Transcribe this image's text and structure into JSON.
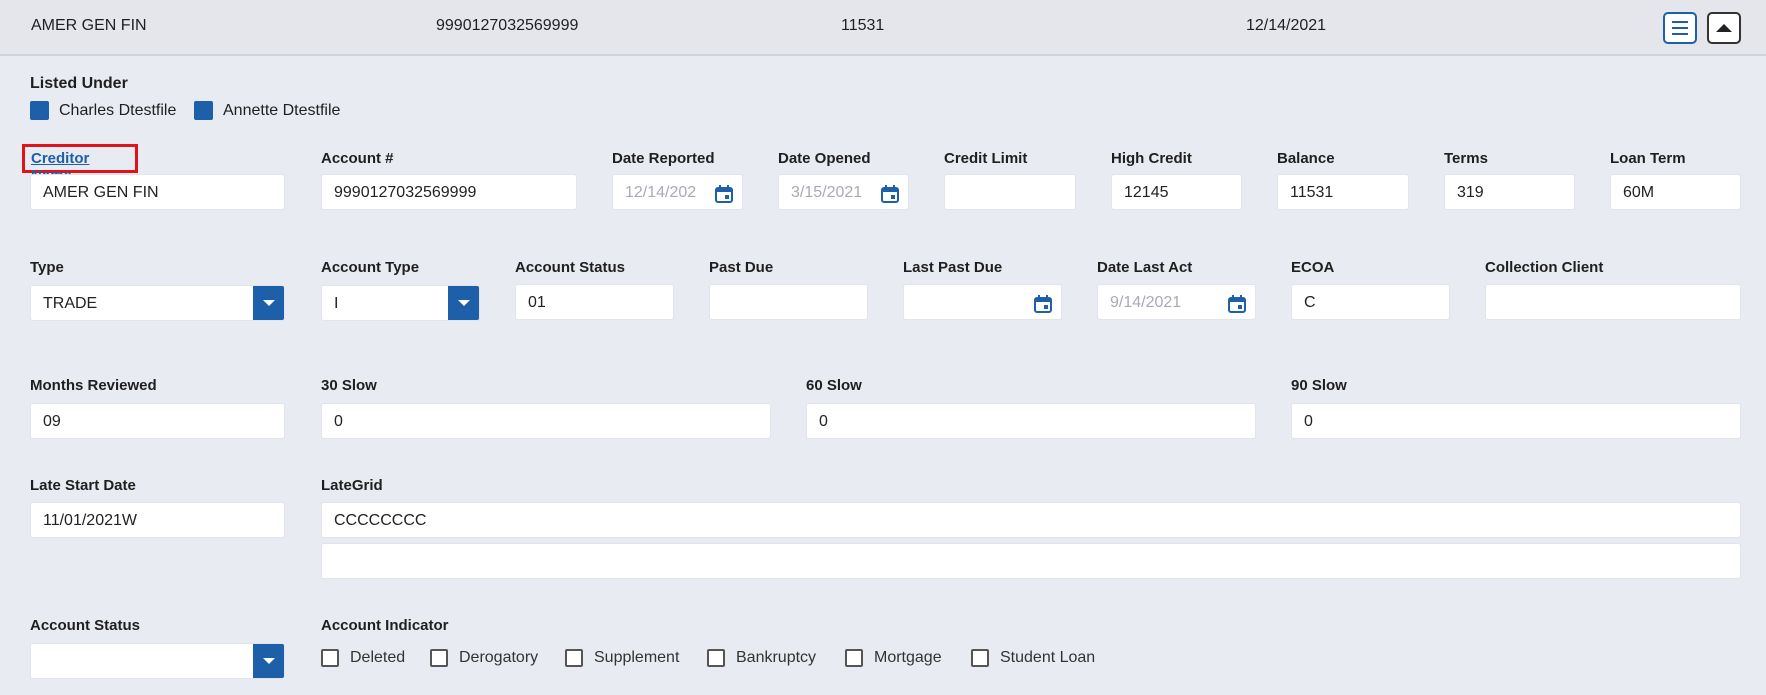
{
  "header": {
    "creditor": "AMER GEN FIN",
    "account": "9990127032569999",
    "balance": "11531",
    "date": "12/14/2021"
  },
  "listed_under": {
    "label": "Listed Under",
    "names": [
      "Charles Dtestfile",
      "Annette Dtestfile"
    ]
  },
  "row1": {
    "creditor_name_label": "Creditor Name",
    "creditor_name": "AMER GEN FIN",
    "account_label": "Account #",
    "account": "9990127032569999",
    "date_reported_label": "Date Reported",
    "date_reported": "12/14/202",
    "date_opened_label": "Date Opened",
    "date_opened": "3/15/2021",
    "credit_limit_label": "Credit Limit",
    "credit_limit": "",
    "high_credit_label": "High Credit",
    "high_credit": "12145",
    "balance_label": "Balance",
    "balance": "11531",
    "terms_label": "Terms",
    "terms": "319",
    "loan_term_label": "Loan Term",
    "loan_term": "60M"
  },
  "row2": {
    "type_label": "Type",
    "type": "TRADE",
    "account_type_label": "Account Type",
    "account_type": "I",
    "account_status_label": "Account Status",
    "account_status": "01",
    "past_due_label": "Past Due",
    "past_due": "",
    "last_past_due_label": "Last Past Due",
    "last_past_due": "",
    "date_last_act_label": "Date Last Act",
    "date_last_act": "9/14/2021",
    "ecoa_label": "ECOA",
    "ecoa": "C",
    "collection_client_label": "Collection Client",
    "collection_client": ""
  },
  "row3": {
    "months_reviewed_label": "Months Reviewed",
    "months_reviewed": "09",
    "slow30_label": "30 Slow",
    "slow30": "0",
    "slow60_label": "60 Slow",
    "slow60": "0",
    "slow90_label": "90 Slow",
    "slow90": "0"
  },
  "row4": {
    "late_start_label": "Late Start Date",
    "late_start": "11/01/2021W",
    "lategrid_label": "LateGrid",
    "lategrid1": "CCCCCCCC",
    "lategrid2": ""
  },
  "row5": {
    "account_status_label": "Account Status",
    "account_status": "",
    "indicator_label": "Account Indicator",
    "indicators": [
      "Deleted",
      "Derogatory",
      "Supplement",
      "Bankruptcy",
      "Mortgage",
      "Student Loan"
    ]
  },
  "colors": {
    "accent": "#1d5fa8",
    "highlight": "#e0131a",
    "background": "#e8ebf2"
  }
}
